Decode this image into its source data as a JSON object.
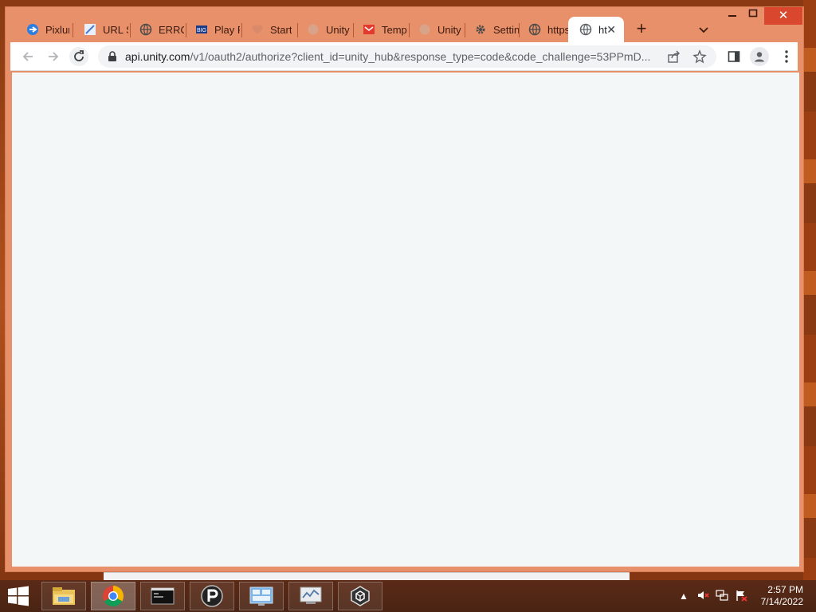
{
  "browser": {
    "tabs": [
      {
        "label": "Pixlur",
        "icon": "pixlr-icon"
      },
      {
        "label": "URL S",
        "icon": "url-shortener-icon"
      },
      {
        "label": "ERRO",
        "icon": "globe-icon"
      },
      {
        "label": "Play F",
        "icon": "play-icon"
      },
      {
        "label": "Start",
        "icon": "heart-icon"
      },
      {
        "label": "Unity",
        "icon": "unity-icon"
      },
      {
        "label": "Temp",
        "icon": "mail-icon"
      },
      {
        "label": "Unity",
        "icon": "unity-icon"
      },
      {
        "label": "Settin",
        "icon": "gear-icon"
      },
      {
        "label": "https:",
        "icon": "globe-icon"
      },
      {
        "label": "ht",
        "icon": "globe-icon",
        "active": true
      }
    ],
    "address_bar": {
      "host": "api.unity.com",
      "path": "/v1/oauth2/authorize?client_id=unity_hub&response_type=code&code_challenge=53PPmD..."
    }
  },
  "taskbar": {
    "apps": [
      "file-explorer",
      "chrome",
      "terminal",
      "pixel-app",
      "control-panel",
      "performance-monitor",
      "unity"
    ],
    "clock": {
      "time": "2:57 PM",
      "date": "7/14/2022"
    }
  },
  "colors": {
    "window_frame": "#e8906a",
    "close_button": "#d9482e",
    "content_bg": "#f4f7f8"
  }
}
